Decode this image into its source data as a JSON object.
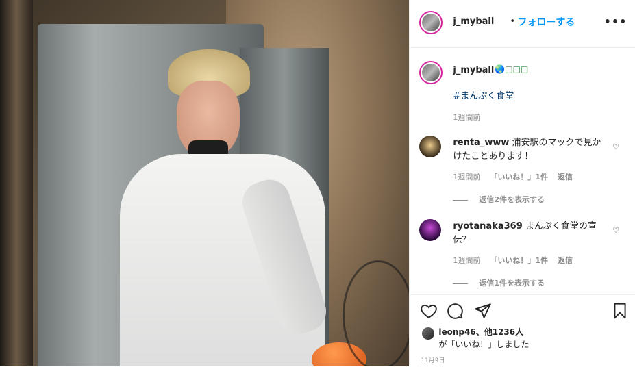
{
  "post": {
    "username": "j_myball",
    "dot": "•",
    "follow_label": "フォローする",
    "more_icon": "•••"
  },
  "caption": {
    "username": "j_myball",
    "emoji": "🌏□□□",
    "hashtag": "#まんぷく食堂",
    "time": "1週間前"
  },
  "comments": [
    {
      "username": "renta_www",
      "text": "浦安駅のマックで見かけたことあります！",
      "time": "1週間前",
      "likes": "「いいね！」1件",
      "reply": "返信",
      "view_replies": "返信2件を表示する"
    },
    {
      "username": "ryotanaka369",
      "text": "まんぷく食堂の宣伝？",
      "time": "1週間前",
      "likes": "「いいね！」1件",
      "reply": "返信",
      "view_replies": "返信1件を表示する"
    }
  ],
  "likes": {
    "line1_user": "leonp46",
    "line1_rest": "、他1236人",
    "line2": "が「いいね！」しました"
  },
  "date": "11月9日",
  "colors": {
    "accent": "#0095f6",
    "border": "#efefef",
    "muted": "#8e8e8e"
  }
}
